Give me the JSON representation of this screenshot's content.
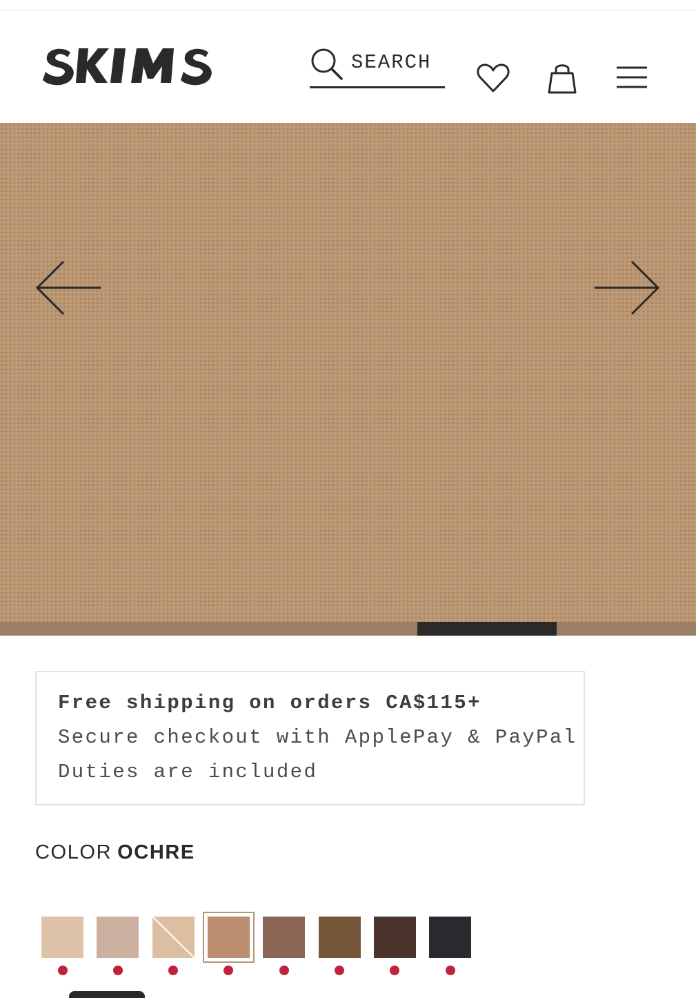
{
  "header": {
    "logo_text": "SKIMS",
    "search_label": "SEARCH",
    "icons": {
      "search": "search-icon",
      "wishlist": "heart-icon",
      "bag": "shopping-bag-icon",
      "menu": "hamburger-menu-icon"
    }
  },
  "hero": {
    "prev_icon": "arrow-left-icon",
    "next_icon": "arrow-right-icon",
    "fabric_color": "#bb9773",
    "carousel_progress": {
      "segment_start": 0.6,
      "segment_end": 0.8
    }
  },
  "shipping_info": {
    "line1": "Free shipping on orders CA$115+",
    "line2": "Secure checkout with ApplePay & PayPal",
    "line3": "Duties are included"
  },
  "color": {
    "label": "COLOR",
    "selected": "OCHRE",
    "swatches": [
      {
        "color": "#dfc3a8",
        "dot": "#c0223d",
        "selected": false,
        "unavailable": false
      },
      {
        "color": "#cdb1a0",
        "dot": "#c0223d",
        "selected": false,
        "unavailable": false
      },
      {
        "color": "#dcbfa1",
        "dot": "#c0223d",
        "selected": false,
        "unavailable": true
      },
      {
        "color": "#b98d6e",
        "dot": "#c0223d",
        "selected": true,
        "unavailable": false
      },
      {
        "color": "#8c6655",
        "dot": "#c0223d",
        "selected": false,
        "unavailable": false
      },
      {
        "color": "#77573a",
        "dot": "#c0223d",
        "selected": false,
        "unavailable": false
      },
      {
        "color": "#4a342c",
        "dot": "#c0223d",
        "selected": false,
        "unavailable": false
      },
      {
        "color": "#2a2b2e",
        "dot": "#c0223d",
        "selected": false,
        "unavailable": false
      }
    ]
  }
}
